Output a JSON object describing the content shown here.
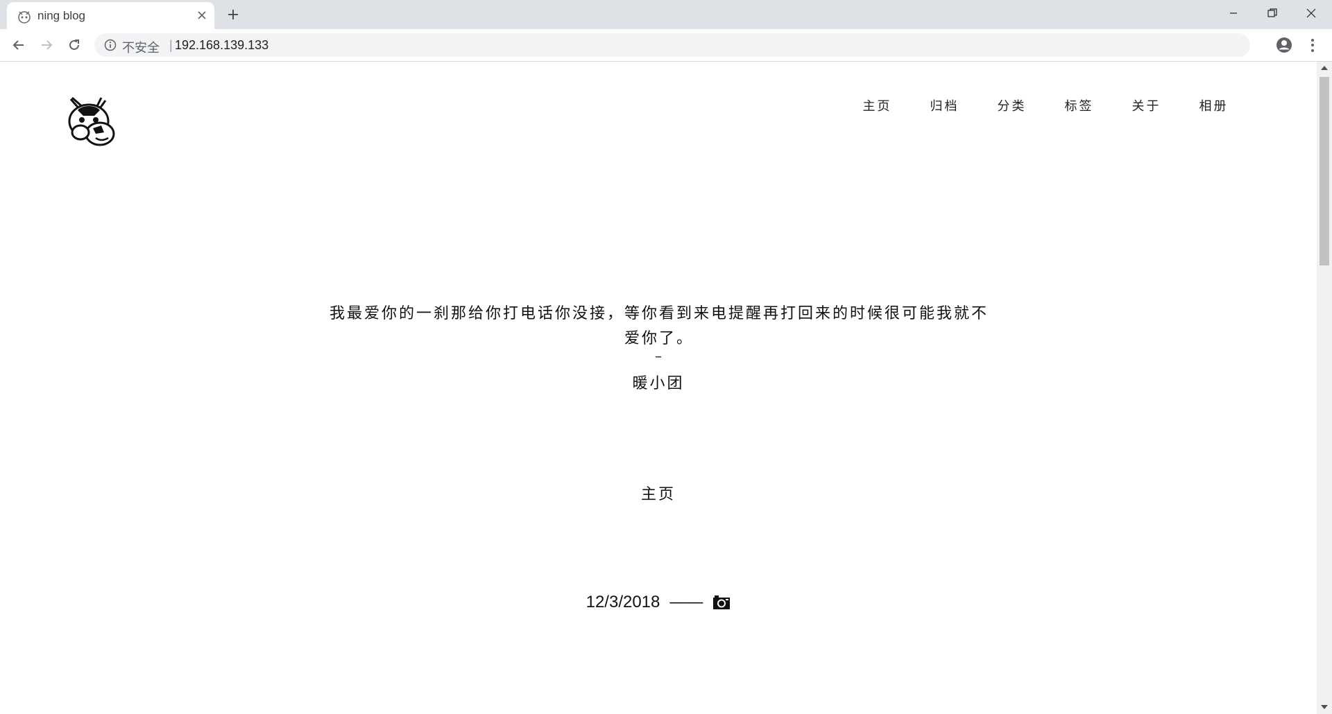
{
  "browser": {
    "tab_title": "ning blog",
    "security_label": "不安全",
    "separator": "|",
    "url": "192.168.139.133"
  },
  "nav": {
    "items": [
      {
        "label": "主页"
      },
      {
        "label": "归档"
      },
      {
        "label": "分类"
      },
      {
        "label": "标签"
      },
      {
        "label": "关于"
      },
      {
        "label": "相册"
      }
    ]
  },
  "hero": {
    "quote": "我最爱你的一刹那给你打电话你没接，等你看到来电提醒再打回来的时候很可能我就不爱你了。",
    "dash": "–",
    "author": "暖小团"
  },
  "section": {
    "heading": "主页"
  },
  "post": {
    "date": "12/3/2018",
    "separator": "——",
    "icon": "camera-icon"
  }
}
